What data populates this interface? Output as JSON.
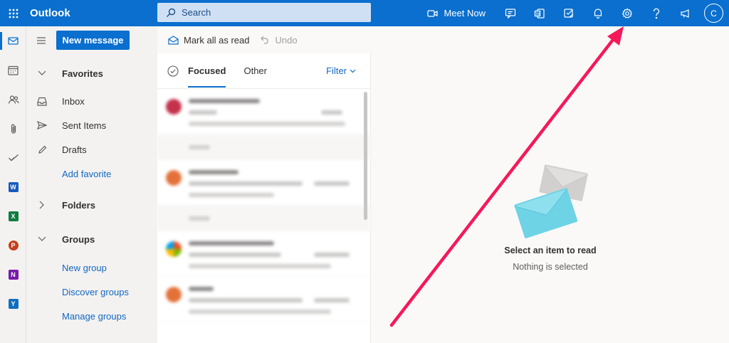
{
  "app": {
    "title": "Outlook"
  },
  "search": {
    "placeholder": "Search"
  },
  "topbar": {
    "meet_now": "Meet Now",
    "avatar_initial": "C"
  },
  "toolbar": {
    "new_message": "New message",
    "mark_all_read": "Mark all as read",
    "undo": "Undo"
  },
  "nav": {
    "favorites": "Favorites",
    "inbox": "Inbox",
    "sent": "Sent Items",
    "drafts": "Drafts",
    "add_favorite": "Add favorite",
    "folders": "Folders",
    "groups": "Groups",
    "new_group": "New group",
    "discover_groups": "Discover groups",
    "manage_groups": "Manage groups"
  },
  "list": {
    "tab_focused": "Focused",
    "tab_other": "Other",
    "filter": "Filter"
  },
  "reading": {
    "title": "Select an item to read",
    "subtitle": "Nothing is selected"
  },
  "colors": {
    "brand": "#0a6fce",
    "annotation": "#f5195a"
  }
}
